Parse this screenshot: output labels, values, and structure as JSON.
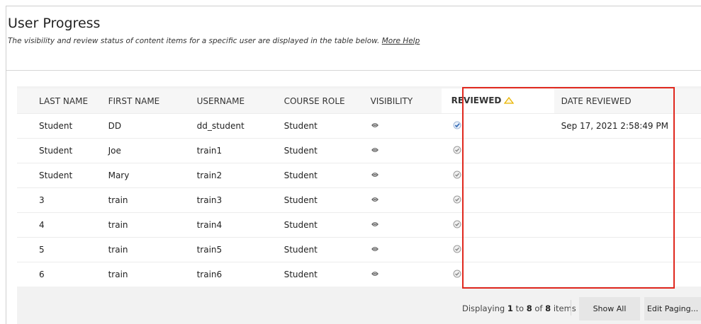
{
  "page": {
    "title": "User Progress",
    "instructions": "The visibility and review status of content items for a specific user are displayed in the table below.",
    "help_link": "More Help"
  },
  "table": {
    "columns": [
      "LAST NAME",
      "FIRST NAME",
      "USERNAME",
      "COURSE ROLE",
      "VISIBILITY",
      "REVIEWED",
      "DATE REVIEWED"
    ],
    "sorted_column": "REVIEWED",
    "rows": [
      {
        "last": "Student",
        "first": "DD",
        "username": "dd_student",
        "role": "Student",
        "visibility_icon": "eye-icon",
        "reviewed": true,
        "date": "Sep 17, 2021 2:58:49 PM"
      },
      {
        "last": "Student",
        "first": "Joe",
        "username": "train1",
        "role": "Student",
        "visibility_icon": "eye-icon",
        "reviewed": false,
        "date": ""
      },
      {
        "last": "Student",
        "first": "Mary",
        "username": "train2",
        "role": "Student",
        "visibility_icon": "eye-icon",
        "reviewed": false,
        "date": ""
      },
      {
        "last": "3",
        "first": "train",
        "username": "train3",
        "role": "Student",
        "visibility_icon": "eye-icon",
        "reviewed": false,
        "date": ""
      },
      {
        "last": "4",
        "first": "train",
        "username": "train4",
        "role": "Student",
        "visibility_icon": "eye-icon",
        "reviewed": false,
        "date": ""
      },
      {
        "last": "5",
        "first": "train",
        "username": "train5",
        "role": "Student",
        "visibility_icon": "eye-icon",
        "reviewed": false,
        "date": ""
      },
      {
        "last": "6",
        "first": "train",
        "username": "train6",
        "role": "Student",
        "visibility_icon": "eye-icon",
        "reviewed": false,
        "date": ""
      }
    ]
  },
  "footer": {
    "prefix": "Displaying",
    "from": "1",
    "to_word": "to",
    "to": "8",
    "of_word": "of",
    "total": "8",
    "suffix": "items",
    "show_all": "Show All",
    "edit_paging": "Edit Paging..."
  },
  "colors": {
    "highlight_border": "#e0281e",
    "sort_indicator": "#e8b400",
    "reviewed_check": "#3b6fb6"
  }
}
